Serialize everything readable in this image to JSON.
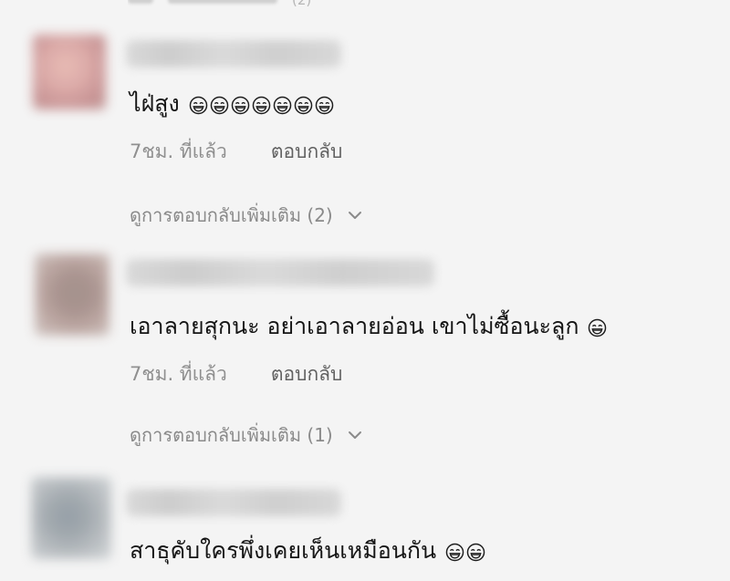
{
  "top_fragment": {
    "text": "(2)"
  },
  "comments": [
    {
      "text": "ไฝ่สูง",
      "emoji_count": 7,
      "time": "7ชม. ที่แล้ว",
      "reply_label": "ตอบกลับ",
      "view_replies": "ดูการตอบกลับเพิ่มเติม (2)"
    },
    {
      "text": "เอาลายสุกนะ อย่าเอาลายอ่อน เขาไม่ซื้อนะลูก",
      "emoji_count": 1,
      "time": "7ชม. ที่แล้ว",
      "reply_label": "ตอบกลับ",
      "view_replies": "ดูการตอบกลับเพิ่มเติม (1)"
    },
    {
      "text": "สาธุคับใครพึ่งเคยเห็นเหมือนกัน",
      "emoji_count": 2
    }
  ],
  "icons": {
    "smiley": "grinning-squint-face-icon",
    "chevron": "chevron-down-icon"
  },
  "colors": {
    "background": "#f4f4f4",
    "text": "#161616",
    "muted": "#8f8f8f"
  }
}
